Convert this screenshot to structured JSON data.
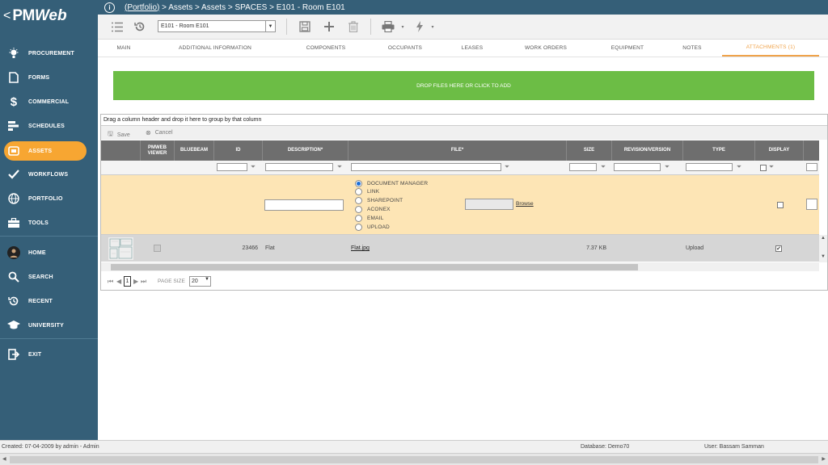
{
  "app": {
    "logo_prefix": "<",
    "logo_pm": "PM",
    "logo_web": "Web"
  },
  "sidebar": {
    "items": [
      {
        "label": "PROCUREMENT"
      },
      {
        "label": "FORMS"
      },
      {
        "label": "COMMERCIAL"
      },
      {
        "label": "SCHEDULES"
      },
      {
        "label": "ASSETS"
      },
      {
        "label": "WORKFLOWS"
      },
      {
        "label": "PORTFOLIO"
      },
      {
        "label": "TOOLS"
      },
      {
        "label": "HOME"
      },
      {
        "label": "SEARCH"
      },
      {
        "label": "RECENT"
      },
      {
        "label": "UNIVERSITY"
      },
      {
        "label": "EXIT"
      }
    ],
    "active_index": 4,
    "active_color": "#f7a632",
    "bg_color": "#355f78"
  },
  "breadcrumb": {
    "link": "(Portfolio)",
    "rest": " > Assets > Assets > SPACES > E101 - Room E101"
  },
  "toolbar": {
    "record_value": "E101 - Room E101"
  },
  "tabs": [
    "MAIN",
    "ADDITIONAL INFORMATION",
    "COMPONENTS",
    "OCCUPANTS",
    "LEASES",
    "WORK ORDERS",
    "EQUIPMENT",
    "NOTES",
    "ATTACHMENTS (1)"
  ],
  "active_tab": 8,
  "dropzone": {
    "label": "DROP FILES HERE OR CLICK TO ADD",
    "color": "#6cbd45"
  },
  "grid": {
    "group_hint": "Drag a column header and drop it here to group by that column",
    "save_label": "Save",
    "cancel_label": "Cancel",
    "columns": [
      "PMWEB VIEWER",
      "BLUEBEAM",
      "ID",
      "DESCRIPTION*",
      "FILE*",
      "SIZE",
      "REVISION/VERSION",
      "TYPE",
      "DISPLAY"
    ],
    "source_options": [
      "DOCUMENT MANAGER",
      "LINK",
      "SHAREPOINT",
      "ACONEX",
      "EMAIL",
      "UPLOAD"
    ],
    "selected_source": "DOCUMENT MANAGER",
    "browse_label": "Browse",
    "rows": [
      {
        "id": "23466",
        "description": "Flat",
        "file": "Flat.jpg",
        "size": "7.37 KB",
        "revision": "",
        "type": "Upload",
        "display": true
      }
    ],
    "pager": {
      "page": "1",
      "page_size_label": "PAGE SIZE",
      "page_size": "20"
    }
  },
  "status": {
    "created": "Created:  07-04-2009 by admin - Admin",
    "database": "Database:  Demo70",
    "user": "User:  Bassam Samman"
  }
}
